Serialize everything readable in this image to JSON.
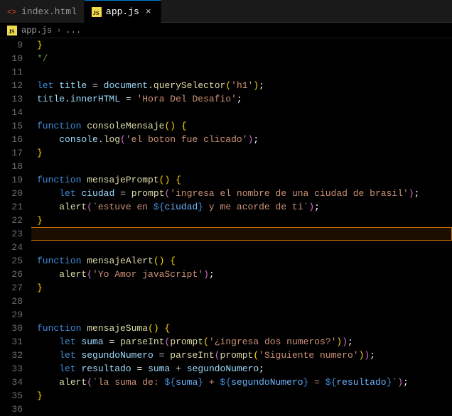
{
  "tabs": [
    {
      "label": "index.html",
      "active": false,
      "close": false,
      "iconColor": "#e44d26"
    },
    {
      "label": "app.js",
      "active": true,
      "close": true,
      "iconColor": "#f0db4f"
    }
  ],
  "breadcrumb": {
    "file": "app.js",
    "rest": "..."
  },
  "lineStart": 9,
  "lines": [
    {
      "n": 9,
      "html": "<span class='brace'>}</span>"
    },
    {
      "n": 10,
      "html": "<span class='cm'>*/</span>"
    },
    {
      "n": 11,
      "html": ""
    },
    {
      "n": 12,
      "html": "<span class='kw'>let</span> <span class='id'>title</span> <span class='op'>=</span> <span class='id'>document</span><span class='pun'>.</span><span class='meth'>querySelector</span><span class='brace'>(</span><span class='str'>'h1'</span><span class='brace'>)</span><span class='semi'>;</span>"
    },
    {
      "n": 13,
      "html": "<span class='id'>title</span><span class='pun'>.</span><span class='prop'>innerHTML</span> <span class='op'>=</span> <span class='str'>'Hora Del Desafio'</span><span class='semi'>;</span>"
    },
    {
      "n": 14,
      "html": ""
    },
    {
      "n": 15,
      "html": "<span class='kw'>function</span> <span class='fn'>consoleMensaje</span><span class='brace'>()</span> <span class='brace'>{</span>"
    },
    {
      "n": 16,
      "html": "    <span class='id'>console</span><span class='pun'>.</span><span class='meth'>log</span><span class='brace2'>(</span><span class='str'>'el boton fue clicado'</span><span class='brace2'>)</span><span class='semi'>;</span>"
    },
    {
      "n": 17,
      "html": "<span class='brace'>}</span>"
    },
    {
      "n": 18,
      "html": ""
    },
    {
      "n": 19,
      "html": "<span class='kw'>function</span> <span class='fn'>mensajePrompt</span><span class='brace'>()</span> <span class='brace'>{</span>"
    },
    {
      "n": 20,
      "html": "    <span class='kw'>let</span> <span class='id'>ciudad</span> <span class='op'>=</span> <span class='meth'>prompt</span><span class='brace2'>(</span><span class='str'>'ingresa el nombre de una ciudad de brasil'</span><span class='brace2'>)</span><span class='semi'>;</span>"
    },
    {
      "n": 21,
      "html": "    <span class='meth'>alert</span><span class='brace2'>(</span><span class='tmpl'>`estuve en </span><span class='builtin'>${</span><span class='tmplvar'>ciudad</span><span class='builtin'>}</span><span class='tmpl'> y me acorde de ti`</span><span class='brace2'>)</span><span class='semi'>;</span>"
    },
    {
      "n": 22,
      "html": "<span class='brace'>}</span>"
    },
    {
      "n": 23,
      "html": "",
      "hl": true
    },
    {
      "n": 24,
      "html": ""
    },
    {
      "n": 25,
      "html": "<span class='kw'>function</span> <span class='fn'>mensajeAlert</span><span class='brace'>()</span> <span class='brace'>{</span>"
    },
    {
      "n": 26,
      "html": "    <span class='meth'>alert</span><span class='brace2'>(</span><span class='str'>'Yo Amor javaScript'</span><span class='brace2'>)</span><span class='semi'>;</span>"
    },
    {
      "n": 27,
      "html": "<span class='brace'>}</span>"
    },
    {
      "n": 28,
      "html": ""
    },
    {
      "n": 29,
      "html": ""
    },
    {
      "n": 30,
      "html": "<span class='kw'>function</span> <span class='fn'>mensajeSuma</span><span class='brace'>()</span> <span class='brace'>{</span>"
    },
    {
      "n": 31,
      "html": "    <span class='kw'>let</span> <span class='id'>suma</span> <span class='op'>=</span> <span class='meth'>parseInt</span><span class='brace2'>(</span><span class='meth'>prompt</span><span class='brace'>(</span><span class='str'>'¿ingresa dos numeros?'</span><span class='brace'>)</span><span class='brace2'>)</span><span class='semi'>;</span>"
    },
    {
      "n": 32,
      "html": "    <span class='kw'>let</span> <span class='id'>segundoNumero</span> <span class='op'>=</span> <span class='meth'>parseInt</span><span class='brace2'>(</span><span class='meth'>prompt</span><span class='brace'>(</span><span class='str'>'Siguiente numero'</span><span class='brace'>)</span><span class='brace2'>)</span><span class='semi'>;</span>"
    },
    {
      "n": 33,
      "html": "    <span class='kw'>let</span> <span class='id'>resultado</span> <span class='op'>=</span> <span class='id'>suma</span> <span class='op'>+</span> <span class='id'>segundoNumero</span><span class='semi'>;</span>"
    },
    {
      "n": 34,
      "html": "    <span class='meth'>alert</span><span class='brace2'>(</span><span class='tmpl'>`la suma de: </span><span class='builtin'>${</span><span class='tmplvar'>suma</span><span class='builtin'>}</span><span class='tmpl'> + </span><span class='builtin'>${</span><span class='tmplvar'>segundoNumero</span><span class='builtin'>}</span><span class='tmpl'> = </span><span class='builtin'>${</span><span class='tmplvar'>resultado</span><span class='builtin'>}</span><span class='tmpl'>`</span><span class='brace2'>)</span><span class='semi'>;</span>"
    },
    {
      "n": 35,
      "html": "<span class='brace'>}</span>"
    },
    {
      "n": 36,
      "html": ""
    }
  ]
}
